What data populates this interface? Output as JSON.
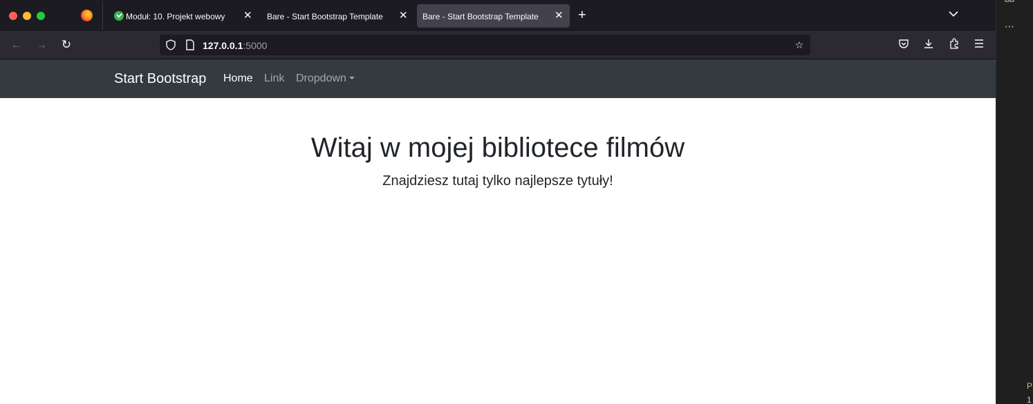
{
  "browser": {
    "tabs": [
      {
        "title": "Moduł: 10. Projekt webowy",
        "active": false
      },
      {
        "title": "Bare - Start Bootstrap Template",
        "active": false
      },
      {
        "title": "Bare - Start Bootstrap Template",
        "active": true
      }
    ],
    "url": {
      "host": "127.0.0.1",
      "port": ":5000"
    }
  },
  "navbar": {
    "brand": "Start Bootstrap",
    "links": [
      {
        "label": "Home",
        "active": true
      },
      {
        "label": "Link",
        "active": false
      },
      {
        "label": "Dropdown",
        "active": false
      }
    ]
  },
  "hero": {
    "title": "Witaj w mojej bibliotece filmów",
    "lead": "Znajdziesz tutaj tylko najlepsze tytuły!"
  },
  "side_panel": {
    "glyphs": [
      "P",
      "1"
    ]
  },
  "colors": {
    "navbar_bg": "#343a40",
    "tabstrip_bg": "#1c1b22",
    "toolbar_bg": "#2b2a33",
    "text_dark": "#212529"
  },
  "icons": [
    "back-arrow-icon",
    "forward-arrow-icon",
    "reload-icon",
    "shield-icon",
    "page-icon",
    "bookmark-star-icon",
    "pocket-icon",
    "download-icon",
    "extensions-icon",
    "menu-icon"
  ]
}
